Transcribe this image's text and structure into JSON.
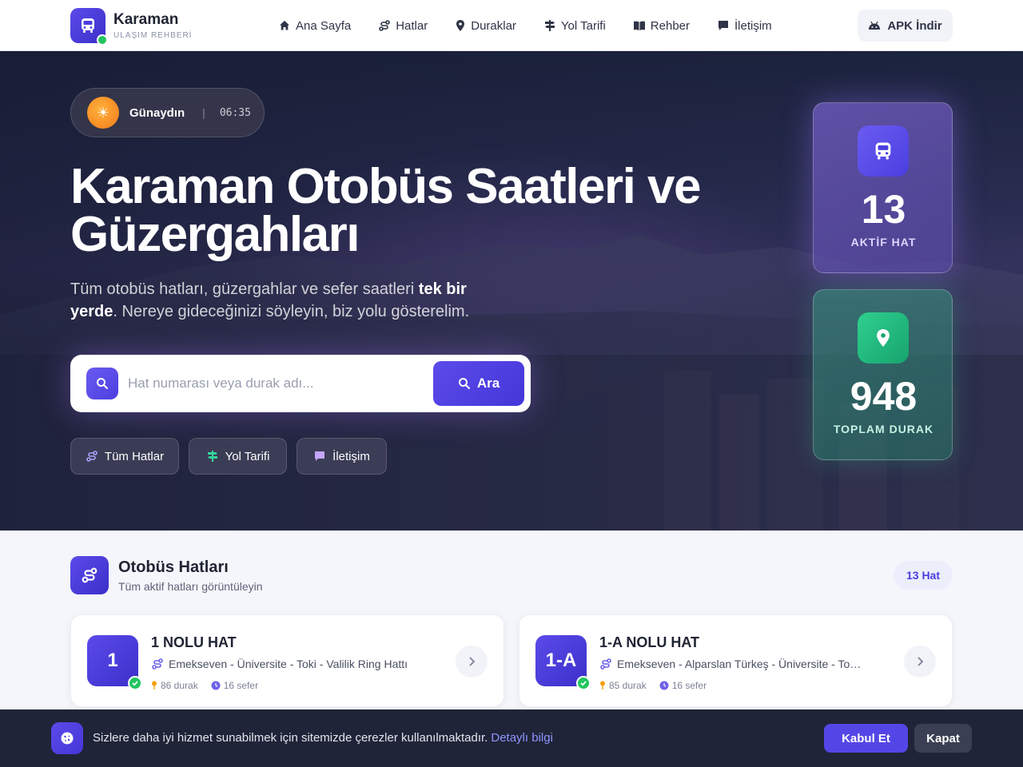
{
  "brand": {
    "title": "Karaman",
    "subtitle": "ULAŞIM REHBERİ"
  },
  "nav": [
    {
      "label": "Ana Sayfa",
      "icon": "home-icon"
    },
    {
      "label": "Hatlar",
      "icon": "route-icon"
    },
    {
      "label": "Duraklar",
      "icon": "map-pin-icon"
    },
    {
      "label": "Yol Tarifi",
      "icon": "signpost-icon"
    },
    {
      "label": "Rehber",
      "icon": "book-icon"
    },
    {
      "label": "İletişim",
      "icon": "chat-icon"
    }
  ],
  "apk_button": "APK İndir",
  "greeting": {
    "text": "Günaydın",
    "separator": "|",
    "time": "06:35"
  },
  "hero": {
    "title": "Karaman Otobüs Saatleri ve Güzergahları",
    "desc_part1": "Tüm otobüs hatları, güzergahlar ve sefer saatleri ",
    "desc_bold": "tek bir yerde",
    "desc_part2": ". Nereye gideceğinizi söyleyin, biz yolu gösterelim."
  },
  "search": {
    "placeholder": "Hat numarası veya durak adı...",
    "button": "Ara"
  },
  "quick_links": [
    {
      "label": "Tüm Hatlar",
      "icon": "route-icon"
    },
    {
      "label": "Yol Tarifi",
      "icon": "signpost-icon"
    },
    {
      "label": "İletişim",
      "icon": "chat-icon"
    }
  ],
  "stats": [
    {
      "value": "13",
      "label": "AKTİF HAT",
      "icon": "bus-icon"
    },
    {
      "value": "948",
      "label": "TOPLAM DURAK",
      "icon": "map-pin-icon"
    }
  ],
  "lines_section": {
    "title": "Otobüs Hatları",
    "subtitle": "Tüm aktif hatları görüntüleyin",
    "count_badge": "13 Hat"
  },
  "lines": [
    {
      "badge": "1",
      "title": "1 NOLU HAT",
      "route": "Emekseven - Üniversite - Toki - Valilik Ring Hattı",
      "stops": "86 durak",
      "trips": "16 sefer"
    },
    {
      "badge": "1-A",
      "title": "1-A NOLU HAT",
      "route": "Emekseven - Alparslan Türkeş - Üniversite - Toki R...",
      "stops": "85 durak",
      "trips": "16 sefer"
    }
  ],
  "cookie": {
    "text": "Sizlere daha iyi hizmet sunabilmek için sitemizde çerezler kullanılmaktadır.",
    "link": "Detaylı bilgi",
    "accept": "Kabul Et",
    "close": "Kapat"
  },
  "colors": {
    "primary": "#4b3ee0",
    "success": "#22c55e",
    "stat_purple": "#7a68d8",
    "stat_teal": "#2f8f7e"
  }
}
